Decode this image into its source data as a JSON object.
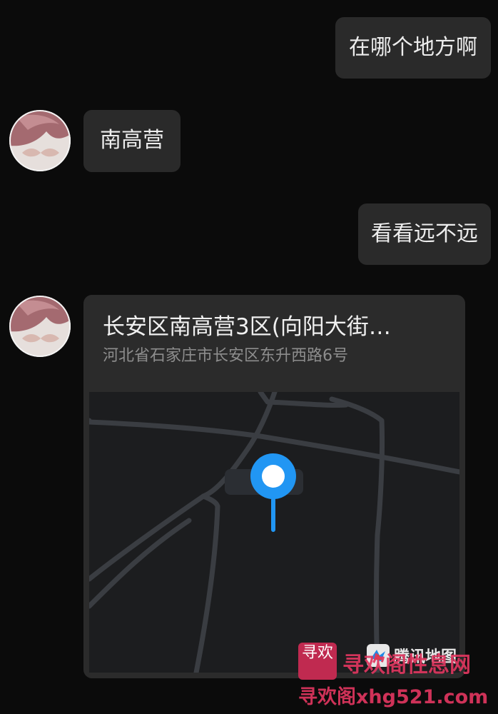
{
  "messages": [
    {
      "sender": "me",
      "type": "text",
      "text": "在哪个地方啊"
    },
    {
      "sender": "contact",
      "type": "text",
      "text": "南高营"
    },
    {
      "sender": "me",
      "type": "text",
      "text": "看看远不远"
    },
    {
      "sender": "contact",
      "type": "location",
      "title": "长安区南高营3区(向阳大街…",
      "address": "河北省石家庄市长安区东升西路6号",
      "map_brand": "腾讯地图"
    }
  ],
  "watermark": {
    "seal_text": "寻欢",
    "title": "寻欢阁性息网",
    "url": "寻欢阁xhg521.com"
  },
  "colors": {
    "background": "#0b0b0b",
    "bubble": "#2a2a2a",
    "map_pin": "#2196f3",
    "watermark": "#e0365f"
  },
  "icons": {
    "avatar": "contact-avatar",
    "pin": "location-pin-icon",
    "brand": "tencent-map-logo"
  }
}
